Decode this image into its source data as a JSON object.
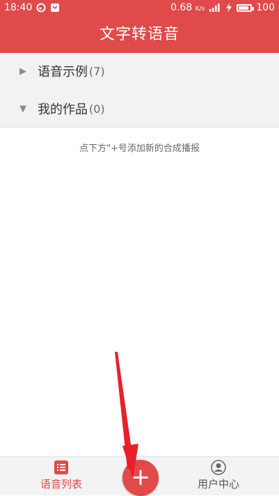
{
  "status_bar": {
    "time": "18:40",
    "speed": "0.68",
    "speed_unit": "K/s",
    "battery": "100",
    "battery_level": 1.0
  },
  "app": {
    "title": "文字转语音"
  },
  "groups": [
    {
      "label": "语音示例",
      "count": "(7)",
      "state": "collapsed"
    },
    {
      "label": "我的作品",
      "count": "(0)",
      "state": "expanded"
    }
  ],
  "empty_hint": "点下方\"+号添加新的合成播报",
  "bottom_nav": {
    "tab_list_label": "语音列表",
    "fab_label": "+",
    "tab_user_label": "用户中心"
  },
  "colors": {
    "accent": "#e04a4a",
    "annotation": "#e8202a"
  }
}
